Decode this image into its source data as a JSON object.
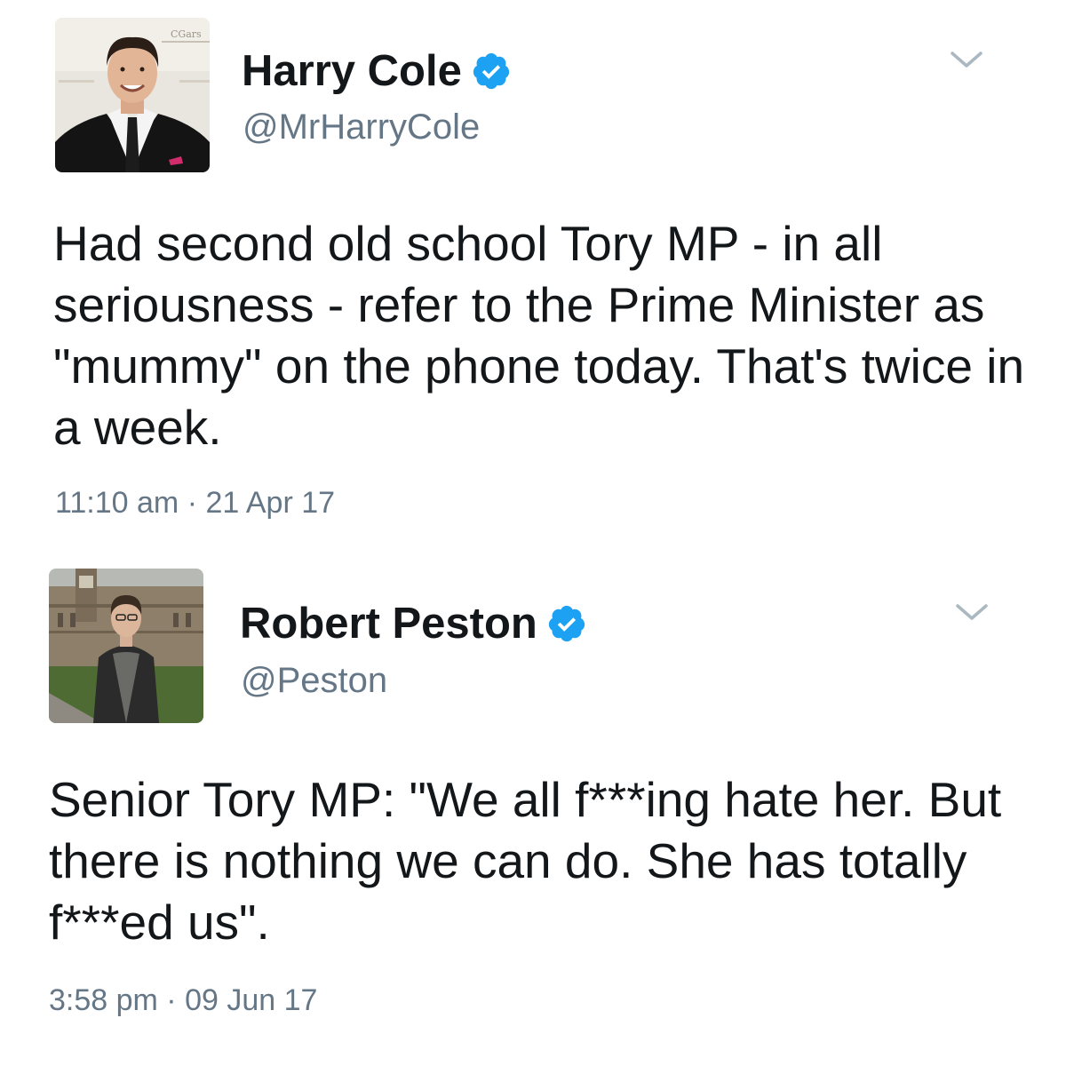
{
  "tweets": [
    {
      "display_name": "Harry Cole",
      "handle": "@MrHarryCole",
      "text": "Had second old school Tory MP - in all seriousness - refer to the Prime Minister as \"mummy\" on the phone today. That's twice in a week.",
      "time": "11:10 am",
      "separator": " · ",
      "date": "21 Apr 17",
      "avatar_sign_text": "CGars"
    },
    {
      "display_name": "Robert Peston",
      "handle": "@Peston",
      "text": "Senior Tory MP: \"We all f***ing hate her. But there is nothing we can do. She has totally f***ed us\".",
      "time": "3:58 pm",
      "separator": " · ",
      "date": "09 Jun 17"
    }
  ],
  "colors": {
    "verified_blue": "#1da1f2",
    "secondary_text": "#657786",
    "primary_text": "#14171a",
    "caret": "#aab8c2"
  },
  "icons": {
    "verified": "verified-badge-icon",
    "menu": "chevron-down-icon"
  }
}
